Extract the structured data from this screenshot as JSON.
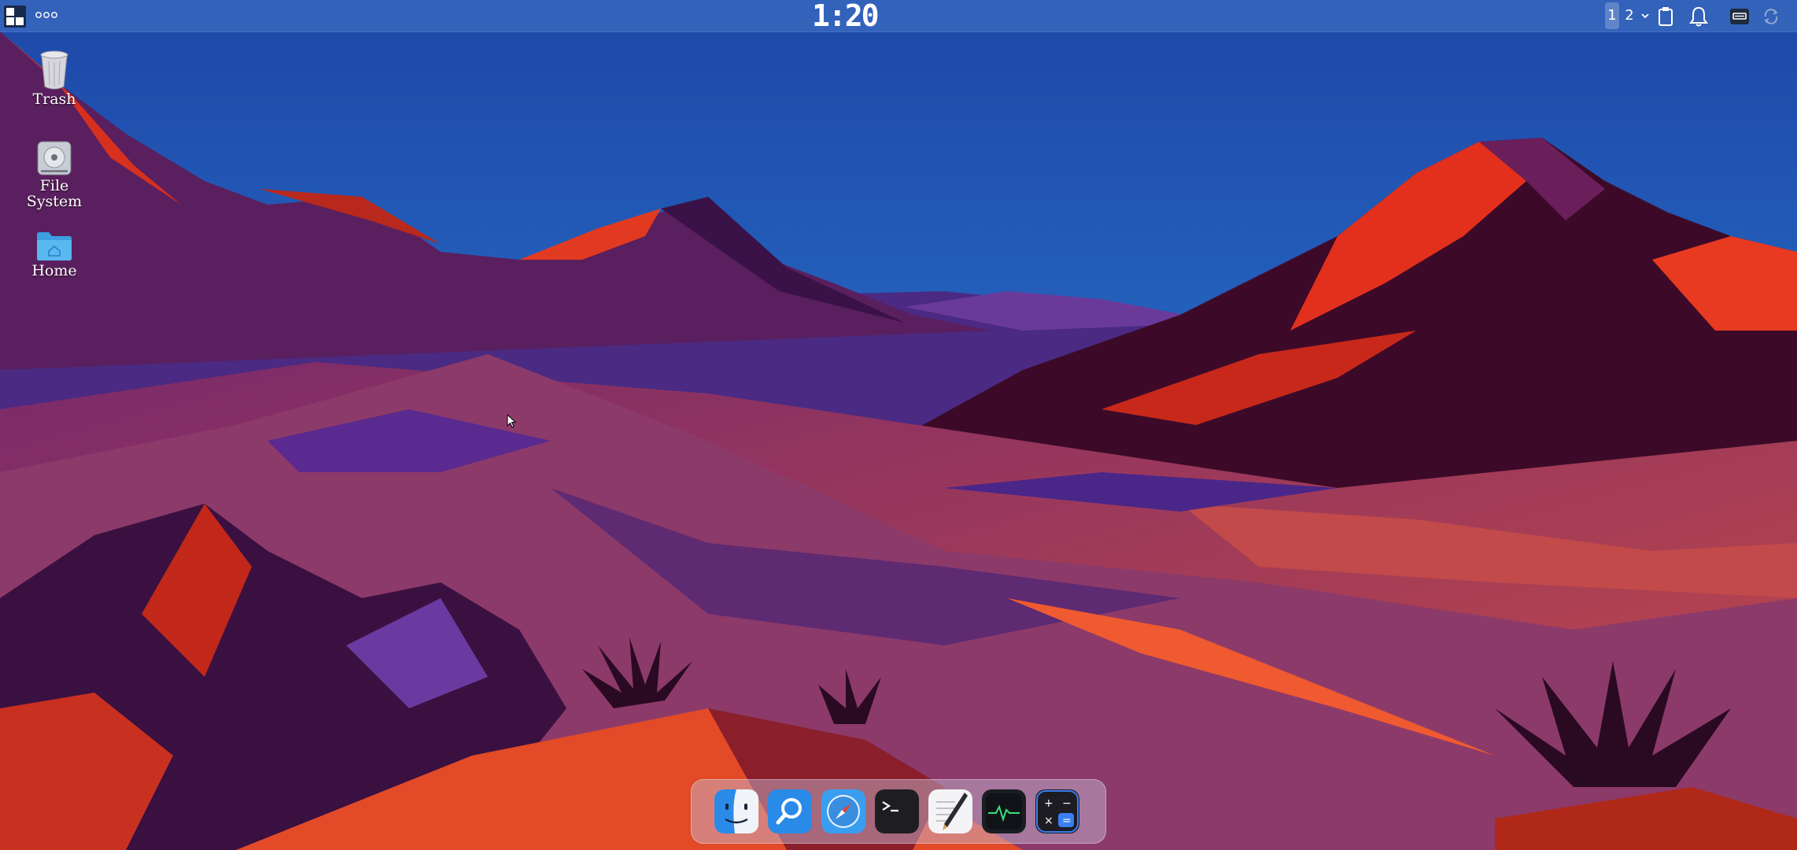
{
  "topbar": {
    "clock": "1:20",
    "workspaces": [
      "1",
      "2"
    ],
    "active_workspace": "1"
  },
  "desktop_icons": [
    {
      "label": "Trash",
      "icon": "trash-icon"
    },
    {
      "label": "File System",
      "icon": "drive-icon"
    },
    {
      "label": "Home",
      "icon": "home-folder-icon"
    }
  ],
  "dock_items": [
    {
      "icon": "finder-icon"
    },
    {
      "icon": "search-icon"
    },
    {
      "icon": "safari-icon"
    },
    {
      "icon": "terminal-icon"
    },
    {
      "icon": "text-editor-icon"
    },
    {
      "icon": "activity-monitor-icon"
    },
    {
      "icon": "calculator-icon"
    }
  ],
  "colors": {
    "sky_top": "#1f4fb0",
    "sky_bottom": "#2d7bd0",
    "mountain_red": "#e0341c",
    "dune_purple": "#5a2b86",
    "dune_orange": "#c94a3a"
  }
}
